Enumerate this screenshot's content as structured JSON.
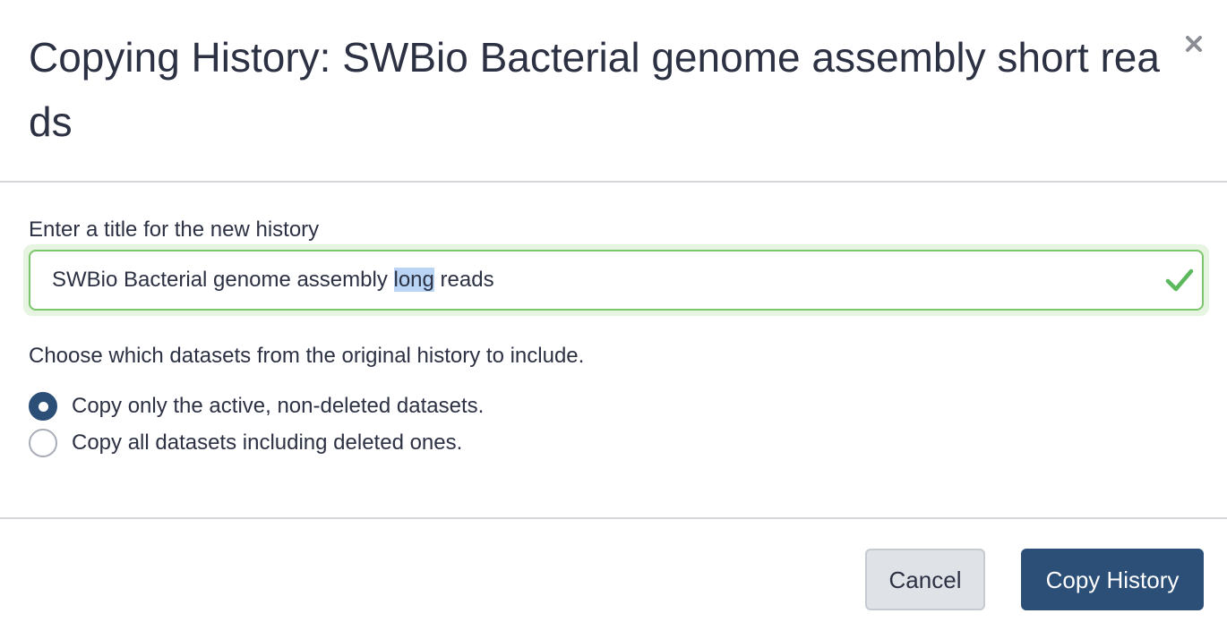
{
  "dialog": {
    "title": "Copying History: SWBio Bacterial genome assembly short reads",
    "close_icon": "close-icon"
  },
  "form": {
    "title_label": "Enter a title for the new history",
    "title_value_before": "SWBio Bacterial genome assembly ",
    "title_value_selected": "long",
    "title_value_after": " reads",
    "valid_icon": "checkmark-icon",
    "valid_color": "#5cb85c",
    "datasets_prompt": "Choose which datasets from the original history to include.",
    "options": [
      {
        "label": "Copy only the active, non-deleted datasets.",
        "selected": true
      },
      {
        "label": "Copy all datasets including deleted ones.",
        "selected": false
      }
    ]
  },
  "footer": {
    "cancel_label": "Cancel",
    "submit_label": "Copy History"
  },
  "colors": {
    "primary": "#2c4f77",
    "valid_border": "#7ac66a",
    "selection": "#b9d4f5"
  }
}
